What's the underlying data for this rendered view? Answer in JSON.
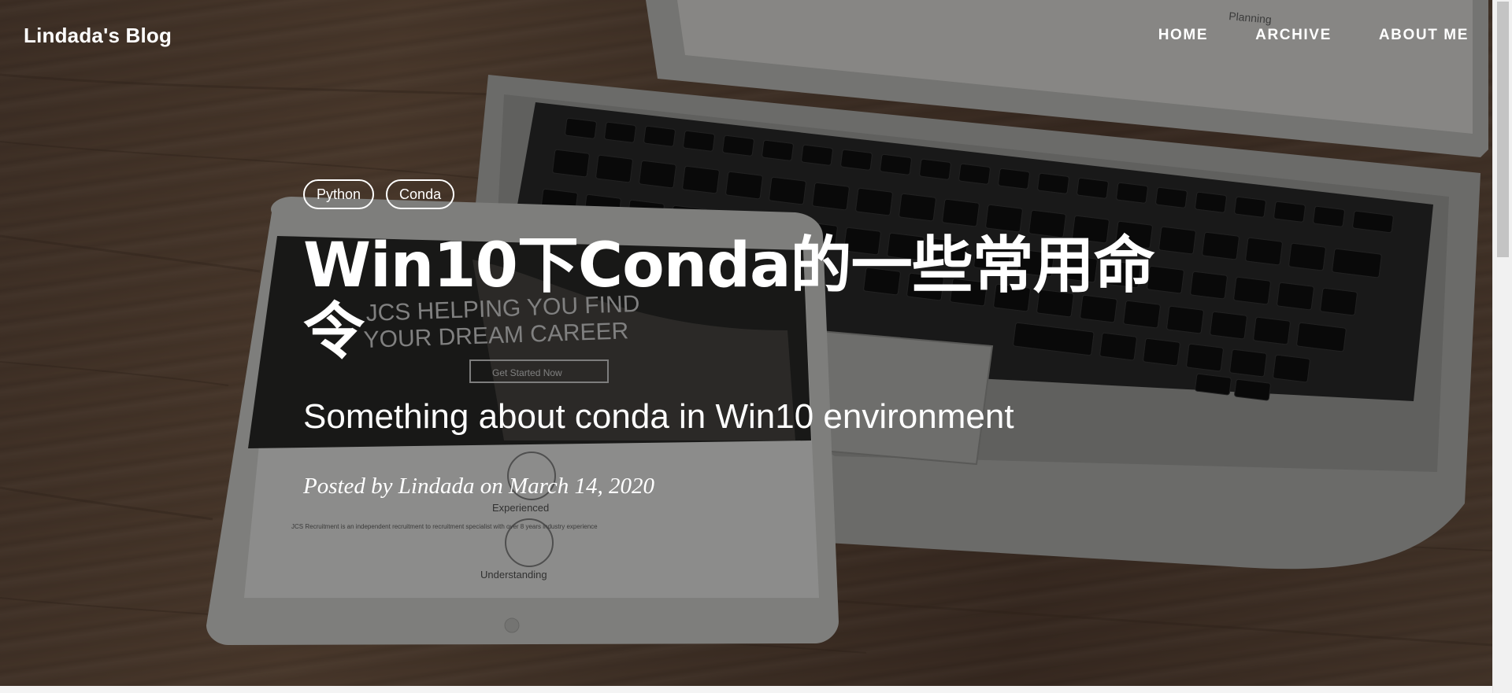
{
  "navbar": {
    "brand": "Lindada's Blog",
    "links": [
      {
        "label": "HOME"
      },
      {
        "label": "ARCHIVE"
      },
      {
        "label": "ABOUT ME"
      }
    ]
  },
  "post": {
    "tags": [
      "Python",
      "Conda"
    ],
    "title": "Win10下Conda的一些常用命令",
    "subtitle": "Something about conda in Win10 environment",
    "meta": "Posted by Lindada on March 14, 2020"
  },
  "hero_image": {
    "screen_text": {
      "headline_line1": "JCS HELPING YOU FIND",
      "headline_line2": "YOUR DREAM CAREER",
      "button": "Get Started Now",
      "section_label": "Experienced",
      "section_text": "JCS Recruitment is an independent recruitment to recruitment specialist with over 8 years industry experience",
      "section_label_2": "Understanding",
      "laptop_heading": "Planning"
    }
  },
  "colors": {
    "overlay": "rgba(0,0,0,0.42)",
    "text": "#ffffff",
    "scrollbar_track": "#f1f1f1",
    "scrollbar_thumb": "#c4c4c4"
  }
}
